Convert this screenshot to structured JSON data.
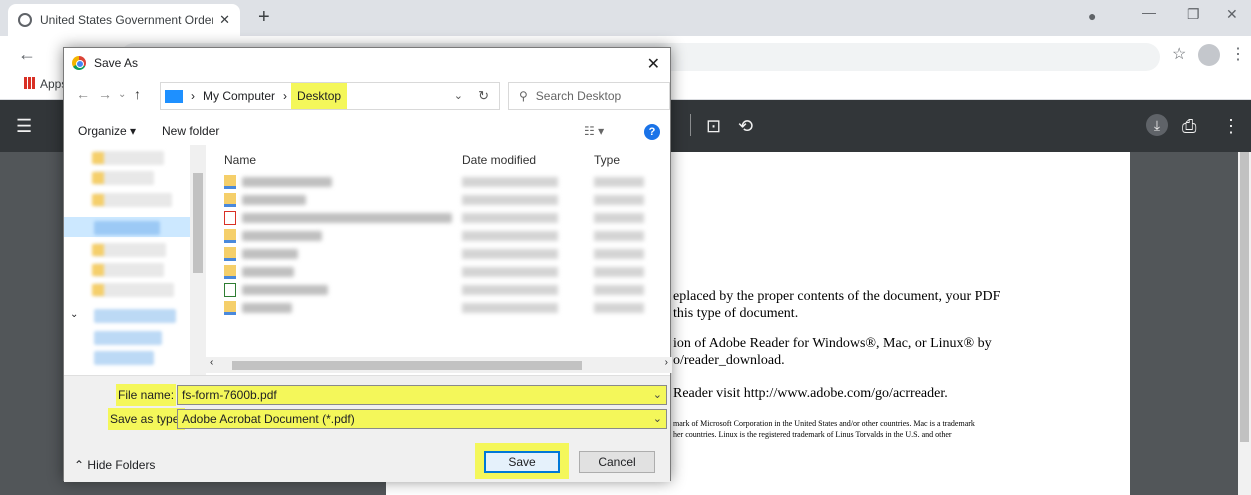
{
  "browser": {
    "tab_title": "United States Government Order",
    "tab_close": "✕",
    "new_tab": "+",
    "bookmarks_apps": "Apps",
    "min": "—",
    "restore": "❐",
    "close": "✕"
  },
  "pdf": {
    "lines": [
      "eplaced by the proper contents of the document, your PDF",
      "this type of document.",
      "ion of Adobe Reader for Windows®, Mac, or Linux® by",
      "o/reader_download.",
      "Reader visit  http://www.adobe.com/go/acrreader.",
      "mark of Microsoft Corporation in the United States and/or other countries. Mac is a trademark",
      "her countries. Linux is the registered trademark of Linus Torvalds in the U.S. and other"
    ]
  },
  "dialog": {
    "title": "Save As",
    "path_root": "My Computer",
    "path_current": "Desktop",
    "search_placeholder": "Search Desktop",
    "organize": "Organize ▾",
    "new_folder": "New folder",
    "help": "?",
    "columns": {
      "name": "Name",
      "date": "Date modified",
      "type": "Type"
    },
    "file_name_label": "File name:",
    "file_name_value": "fs-form-7600b.pdf",
    "save_type_label": "Save as type:",
    "save_type_value": "Adobe Acrobat Document (*.pdf)",
    "hide_folders": "Hide Folders",
    "save": "Save",
    "cancel": "Cancel"
  },
  "colors": {
    "highlight": "#f4f75a",
    "pdf_toolbar": "#323639",
    "viewer_bg": "#525659"
  }
}
